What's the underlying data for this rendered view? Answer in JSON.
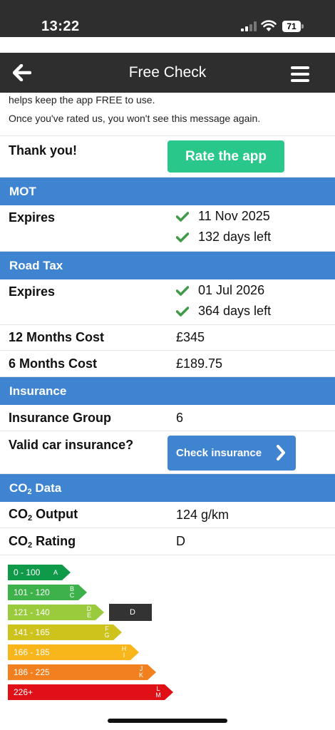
{
  "status_bar": {
    "time": "13:22",
    "battery": "71"
  },
  "nav": {
    "title": "Free Check"
  },
  "notice": {
    "line1": "helps keep the app FREE to use.",
    "line2": "Once you've rated us, you won't see this message again."
  },
  "rate": {
    "label": "Thank you!",
    "button": "Rate the app"
  },
  "mot": {
    "header": "MOT",
    "expires_label": "Expires",
    "expiry_date": "11 Nov 2025",
    "days_left": "132 days left"
  },
  "road_tax": {
    "header": "Road Tax",
    "expires_label": "Expires",
    "expiry_date": "01 Jul 2026",
    "days_left": "364 days left",
    "cost12_label": "12 Months Cost",
    "cost12_value": "£345",
    "cost6_label": "6 Months Cost",
    "cost6_value": "£189.75"
  },
  "insurance": {
    "header": "Insurance",
    "group_label": "Insurance Group",
    "group_value": "6",
    "valid_label": "Valid car insurance?",
    "button": "Check insurance"
  },
  "co2": {
    "header_prefix": "CO",
    "header_sub": "2",
    "header_suffix": " Data",
    "output_prefix": "CO",
    "output_sub": "2",
    "output_suffix": " Output",
    "output_value": "124 g/km",
    "rating_prefix": "CO",
    "rating_sub": "2",
    "rating_suffix": " Rating",
    "rating_value": "D",
    "bands": [
      {
        "range": "0 - 100",
        "letters": "A",
        "color": "#0f9a4a"
      },
      {
        "range": "101 - 120",
        "letters": "B\nC",
        "color": "#3db14a"
      },
      {
        "range": "121 - 140",
        "letters": "D\nE",
        "color": "#9acb3c"
      },
      {
        "range": "141 - 165",
        "letters": "F\nG",
        "color": "#cdc31c"
      },
      {
        "range": "166 - 185",
        "letters": "H\nI",
        "color": "#f9b61b"
      },
      {
        "range": "186 - 225",
        "letters": "J\nK",
        "color": "#f2801f"
      },
      {
        "range": "226+",
        "letters": "L\nM",
        "color": "#e01017"
      }
    ],
    "marker": "D"
  },
  "colors": {
    "accent": "#3f84d1",
    "rate_button": "#29c88a",
    "check": "#3e9a46",
    "bar": "#2e2e2e"
  }
}
